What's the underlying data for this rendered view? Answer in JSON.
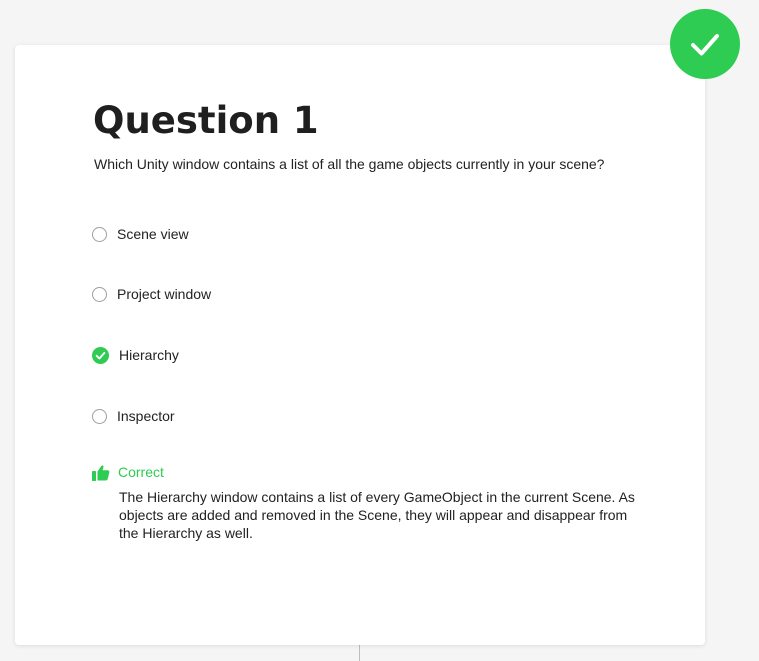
{
  "colors": {
    "accent_green": "#2ecc52",
    "page_background": "#f5f5f5",
    "card_background": "#ffffff",
    "text": "#222222"
  },
  "status_badge": {
    "icon": "checkmark-icon",
    "state": "correct"
  },
  "question": {
    "title": "Question 1",
    "prompt": "Which Unity window contains a list of all the game objects currently in your scene?",
    "options": [
      {
        "label": "Scene view",
        "selected": false
      },
      {
        "label": "Project window",
        "selected": false
      },
      {
        "label": "Hierarchy",
        "selected": true
      },
      {
        "label": "Inspector",
        "selected": false
      }
    ]
  },
  "feedback": {
    "icon": "thumbs-up-icon",
    "label": "Correct",
    "explanation": "The Hierarchy window contains a list of every GameObject in the current Scene. As objects are added and removed in the Scene, they will appear and disappear from the Hierarchy as well."
  }
}
